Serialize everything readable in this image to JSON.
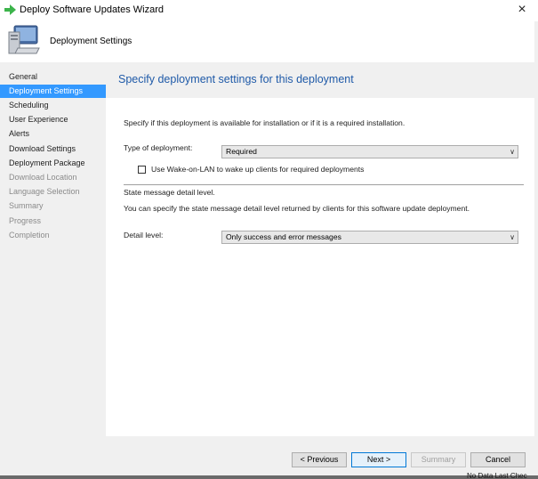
{
  "window": {
    "title": "Deploy Software Updates Wizard",
    "close_glyph": "×",
    "icon": "green-arrow-icon"
  },
  "header": {
    "title": "Deployment Settings",
    "icon": "computer-icon"
  },
  "sidebar": {
    "items": [
      {
        "label": "General",
        "state": "enabled"
      },
      {
        "label": "Deployment Settings",
        "state": "selected"
      },
      {
        "label": "Scheduling",
        "state": "enabled"
      },
      {
        "label": "User Experience",
        "state": "enabled"
      },
      {
        "label": "Alerts",
        "state": "enabled"
      },
      {
        "label": "Download Settings",
        "state": "enabled"
      },
      {
        "label": "Deployment Package",
        "state": "enabled"
      },
      {
        "label": "Download Location",
        "state": "disabled"
      },
      {
        "label": "Language Selection",
        "state": "disabled"
      },
      {
        "label": "Summary",
        "state": "disabled"
      },
      {
        "label": "Progress",
        "state": "disabled"
      },
      {
        "label": "Completion",
        "state": "disabled"
      }
    ]
  },
  "main": {
    "heading": "Specify deployment settings for this deployment",
    "intro": "Specify if this deployment is available for installation or if it is a required installation.",
    "deployment_type_label": "Type of deployment:",
    "deployment_type_value": "Required",
    "wake_on_lan_label": "Use Wake-on-LAN to wake up clients for required deployments",
    "wake_on_lan_checked": false,
    "state_message_title": "State message detail level.",
    "state_message_desc": "You can specify the state message detail level returned by clients for this software update deployment.",
    "detail_level_label": "Detail level:",
    "detail_level_value": "Only success and error messages"
  },
  "buttons": {
    "previous": "< Previous",
    "next": "Next >",
    "summary": "Summary",
    "cancel": "Cancel"
  },
  "colors": {
    "accent": "#3399ff",
    "heading": "#1f5aa8",
    "sidebar_bg": "#f0f0f0"
  },
  "background_overflow_text": "No Data   Last Chec"
}
